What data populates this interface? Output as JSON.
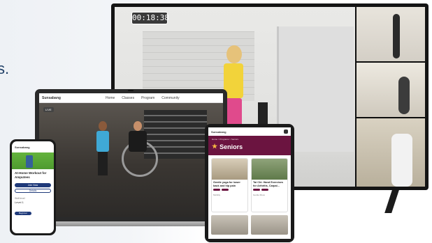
{
  "headline": {
    "text": "s."
  },
  "tv": {
    "timer": "00:18:38"
  },
  "laptop": {
    "brand": "Sunsabang",
    "nav": [
      "Home",
      "Classes",
      "Program",
      "Community"
    ],
    "live_badge": "LIVE"
  },
  "phone": {
    "brand": "Sunsabang",
    "title": "At-Home Workout for Amputees",
    "primary_button": "Join Now",
    "secondary_button": "Details",
    "level_label": "Skill level",
    "level_value": "Level 1",
    "pill": "Beginner"
  },
  "tablet": {
    "brand": "Sunsabang",
    "breadcrumb": "Home > Programs > Seniors",
    "heading": "Seniors",
    "cards": [
      {
        "title": "Gentle yoga for lower back and hip pain",
        "meta": "Mobility"
      },
      {
        "title": "Tai Chi: Hand Exercises for Arthritis, Carpal...",
        "meta": "Gentle Move"
      }
    ]
  },
  "colors": {
    "headline": "#1f3f66",
    "tablet_hero": "#6b1440",
    "phone_hero": "#63b33d",
    "accent_blue": "#1f3a7a"
  }
}
